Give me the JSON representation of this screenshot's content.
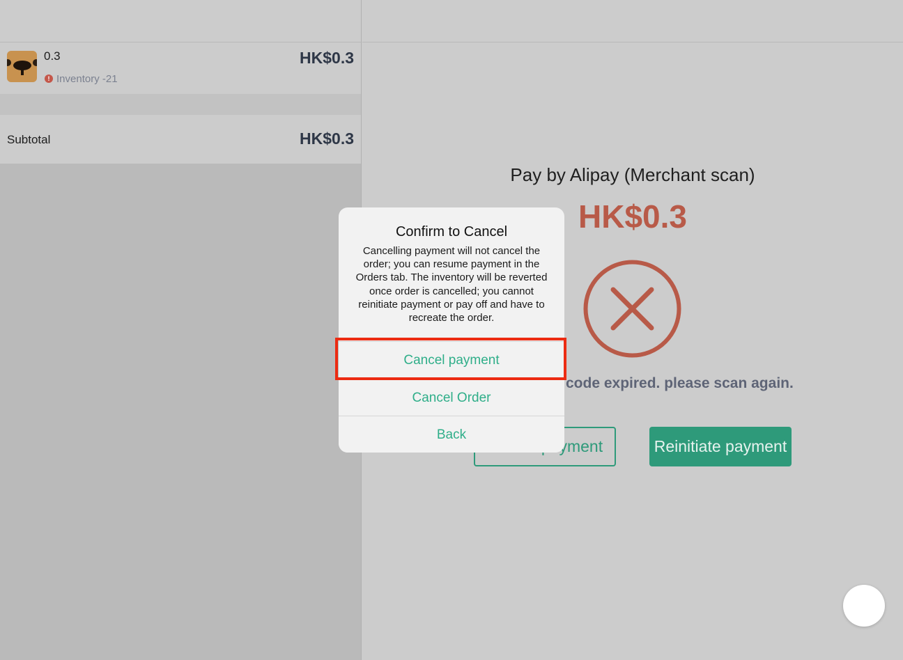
{
  "cart": {
    "item": {
      "name": "0.3",
      "inventory": "Inventory -21",
      "price": "HK$0.3",
      "warning_icon": "exclamation-icon"
    },
    "subtotal_label": "Subtotal",
    "subtotal_value": "HK$0.3"
  },
  "payment": {
    "title": "Pay by Alipay (Merchant scan)",
    "amount": "HK$0.3",
    "status_icon": "error-x-circle-icon",
    "status_text": "code expired. please scan again.",
    "cancel_label": "Cancel payment",
    "reinitiate_label": "Reinitiate payment"
  },
  "dialog": {
    "title": "Confirm to Cancel",
    "message": "Cancelling payment will not cancel the order; you can resume payment in the Orders tab. The inventory will be reverted once order is cancelled; you cannot reinitiate payment or pay off and have to recreate the order.",
    "buttons": [
      "Cancel payment",
      "Cancel Order",
      "Back"
    ]
  },
  "colors": {
    "accent": "#2e9a7a",
    "dialog_action": "#2fae89",
    "error": "#b85a48",
    "highlight": "#ec2b12"
  }
}
